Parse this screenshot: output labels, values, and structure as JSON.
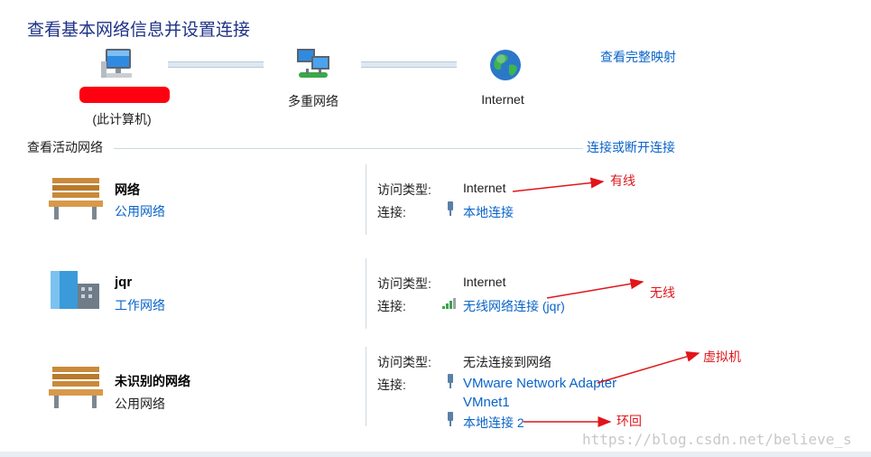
{
  "header": {
    "title": "查看基本网络信息并设置连接",
    "map_link": "查看完整映射"
  },
  "map": {
    "computer_label": "(此计算机)",
    "multi_network_label": "多重网络",
    "internet_label": "Internet"
  },
  "active_section": {
    "title": "查看活动网络",
    "connect_link": "连接或断开连接"
  },
  "labels": {
    "access_type": "访问类型:",
    "connection": "连接:"
  },
  "networks": [
    {
      "name": "网络",
      "type": "公用网络",
      "type_is_link": true,
      "icon": "bench-icon",
      "access_type": "Internet",
      "connections": [
        "本地连接"
      ],
      "connection_icon": "ethernet-plug-icon"
    },
    {
      "name": "jqr",
      "type": "工作网络",
      "type_is_link": true,
      "icon": "office-building-icon",
      "access_type": "Internet",
      "connections": [
        "无线网络连接 (jqr)"
      ],
      "connection_icon": "wifi-signal-icon"
    },
    {
      "name": "未识别的网络",
      "type": "公用网络",
      "type_is_link": false,
      "icon": "bench-icon",
      "access_type": "无法连接到网络",
      "connections": [
        "VMware Network Adapter",
        "VMnet1",
        "本地连接 2"
      ],
      "connection_icon": "ethernet-plug-icon"
    }
  ],
  "annotations": {
    "wired": "有线",
    "wireless": "无线",
    "virtual_machine": "虚拟机",
    "loopback": "环回",
    "color": "#e0151a"
  },
  "watermark": "https://blog.csdn.net/believe_s",
  "colors": {
    "title": "#1e3287",
    "link": "#0a64c8",
    "annotation": "#e0151a"
  }
}
